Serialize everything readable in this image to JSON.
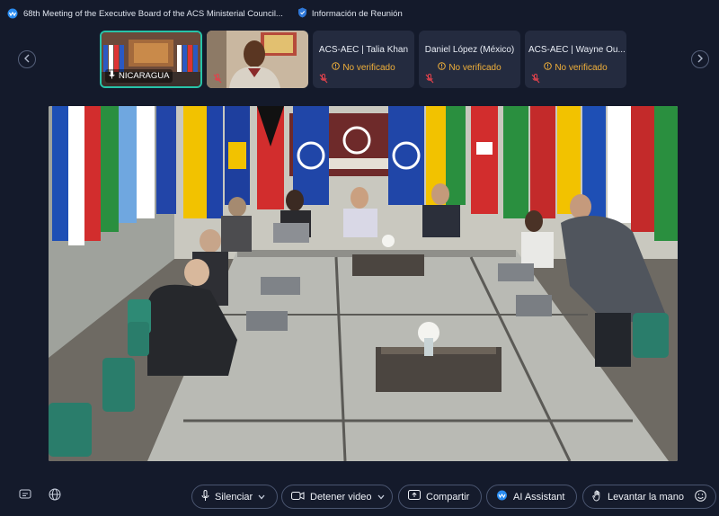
{
  "window": {
    "meeting_title": "68th Meeting of the Executive Board of the ACS Ministerial Council...",
    "info_label": "Información de Reunión"
  },
  "participants": [
    {
      "name": "NICARAGUA",
      "status": ""
    },
    {
      "name": "",
      "status": ""
    },
    {
      "name": "ACS-AEC | Talia Khan",
      "status": "No verificado"
    },
    {
      "name": "Daniel López (México)",
      "status": "No verificado"
    },
    {
      "name": "ACS-AEC | Wayne Ou...",
      "status": "No verificado"
    }
  ],
  "toolbar": {
    "mute_label": "Silenciar",
    "video_label": "Detener video",
    "share_label": "Compartir",
    "ai_label": "AI Assistant",
    "hand_label": "Levantar la mano"
  },
  "colors": {
    "background": "#141a2b",
    "active_speaker_border": "#27c4a8",
    "unverified": "#f1b03a",
    "muted_icon": "#e0424c"
  },
  "icons": {
    "app": "webex-icon",
    "info": "shield-icon",
    "mic": "microphone-icon",
    "camera": "camera-icon",
    "share": "share-icon",
    "hand": "hand-icon",
    "reactions": "smiley-icon",
    "captions": "captions-icon",
    "language": "globe-icon"
  }
}
